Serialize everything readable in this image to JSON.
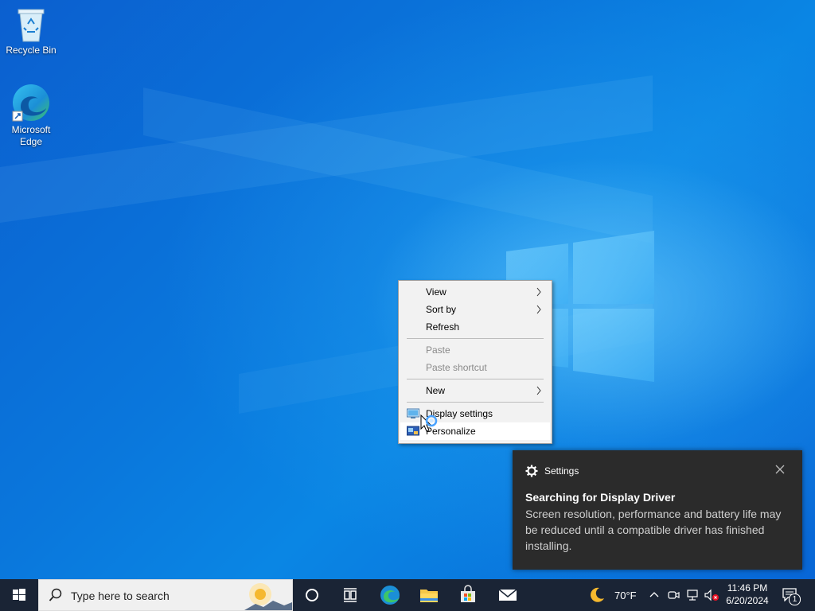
{
  "desktop": {
    "icons": [
      {
        "label": "Recycle Bin",
        "icon": "recycle-bin-icon"
      },
      {
        "label": "Microsoft Edge",
        "icon": "edge-icon"
      }
    ]
  },
  "context_menu": {
    "items": [
      {
        "label": "View",
        "submenu": true,
        "enabled": true
      },
      {
        "label": "Sort by",
        "submenu": true,
        "enabled": true
      },
      {
        "label": "Refresh",
        "submenu": false,
        "enabled": true
      },
      {
        "label": "Paste",
        "submenu": false,
        "enabled": false
      },
      {
        "label": "Paste shortcut",
        "submenu": false,
        "enabled": false
      },
      {
        "label": "New",
        "submenu": true,
        "enabled": true
      },
      {
        "label": "Display settings",
        "submenu": false,
        "enabled": true,
        "icon": "display-settings-icon"
      },
      {
        "label": "Personalize",
        "submenu": false,
        "enabled": true,
        "icon": "personalize-icon"
      }
    ]
  },
  "toast": {
    "app": "Settings",
    "title": "Searching for Display Driver",
    "body": "Screen resolution, performance and battery life may be reduced until a compatible driver has finished installing."
  },
  "taskbar": {
    "search_placeholder": "Type here to search",
    "weather": "70°F",
    "time": "11:46 PM",
    "date": "6/20/2024",
    "notification_count": "1"
  },
  "colors": {
    "desktop_blue": "#0a74d6",
    "taskbar": "#1a2435",
    "toast_bg": "#2b2b2b"
  }
}
